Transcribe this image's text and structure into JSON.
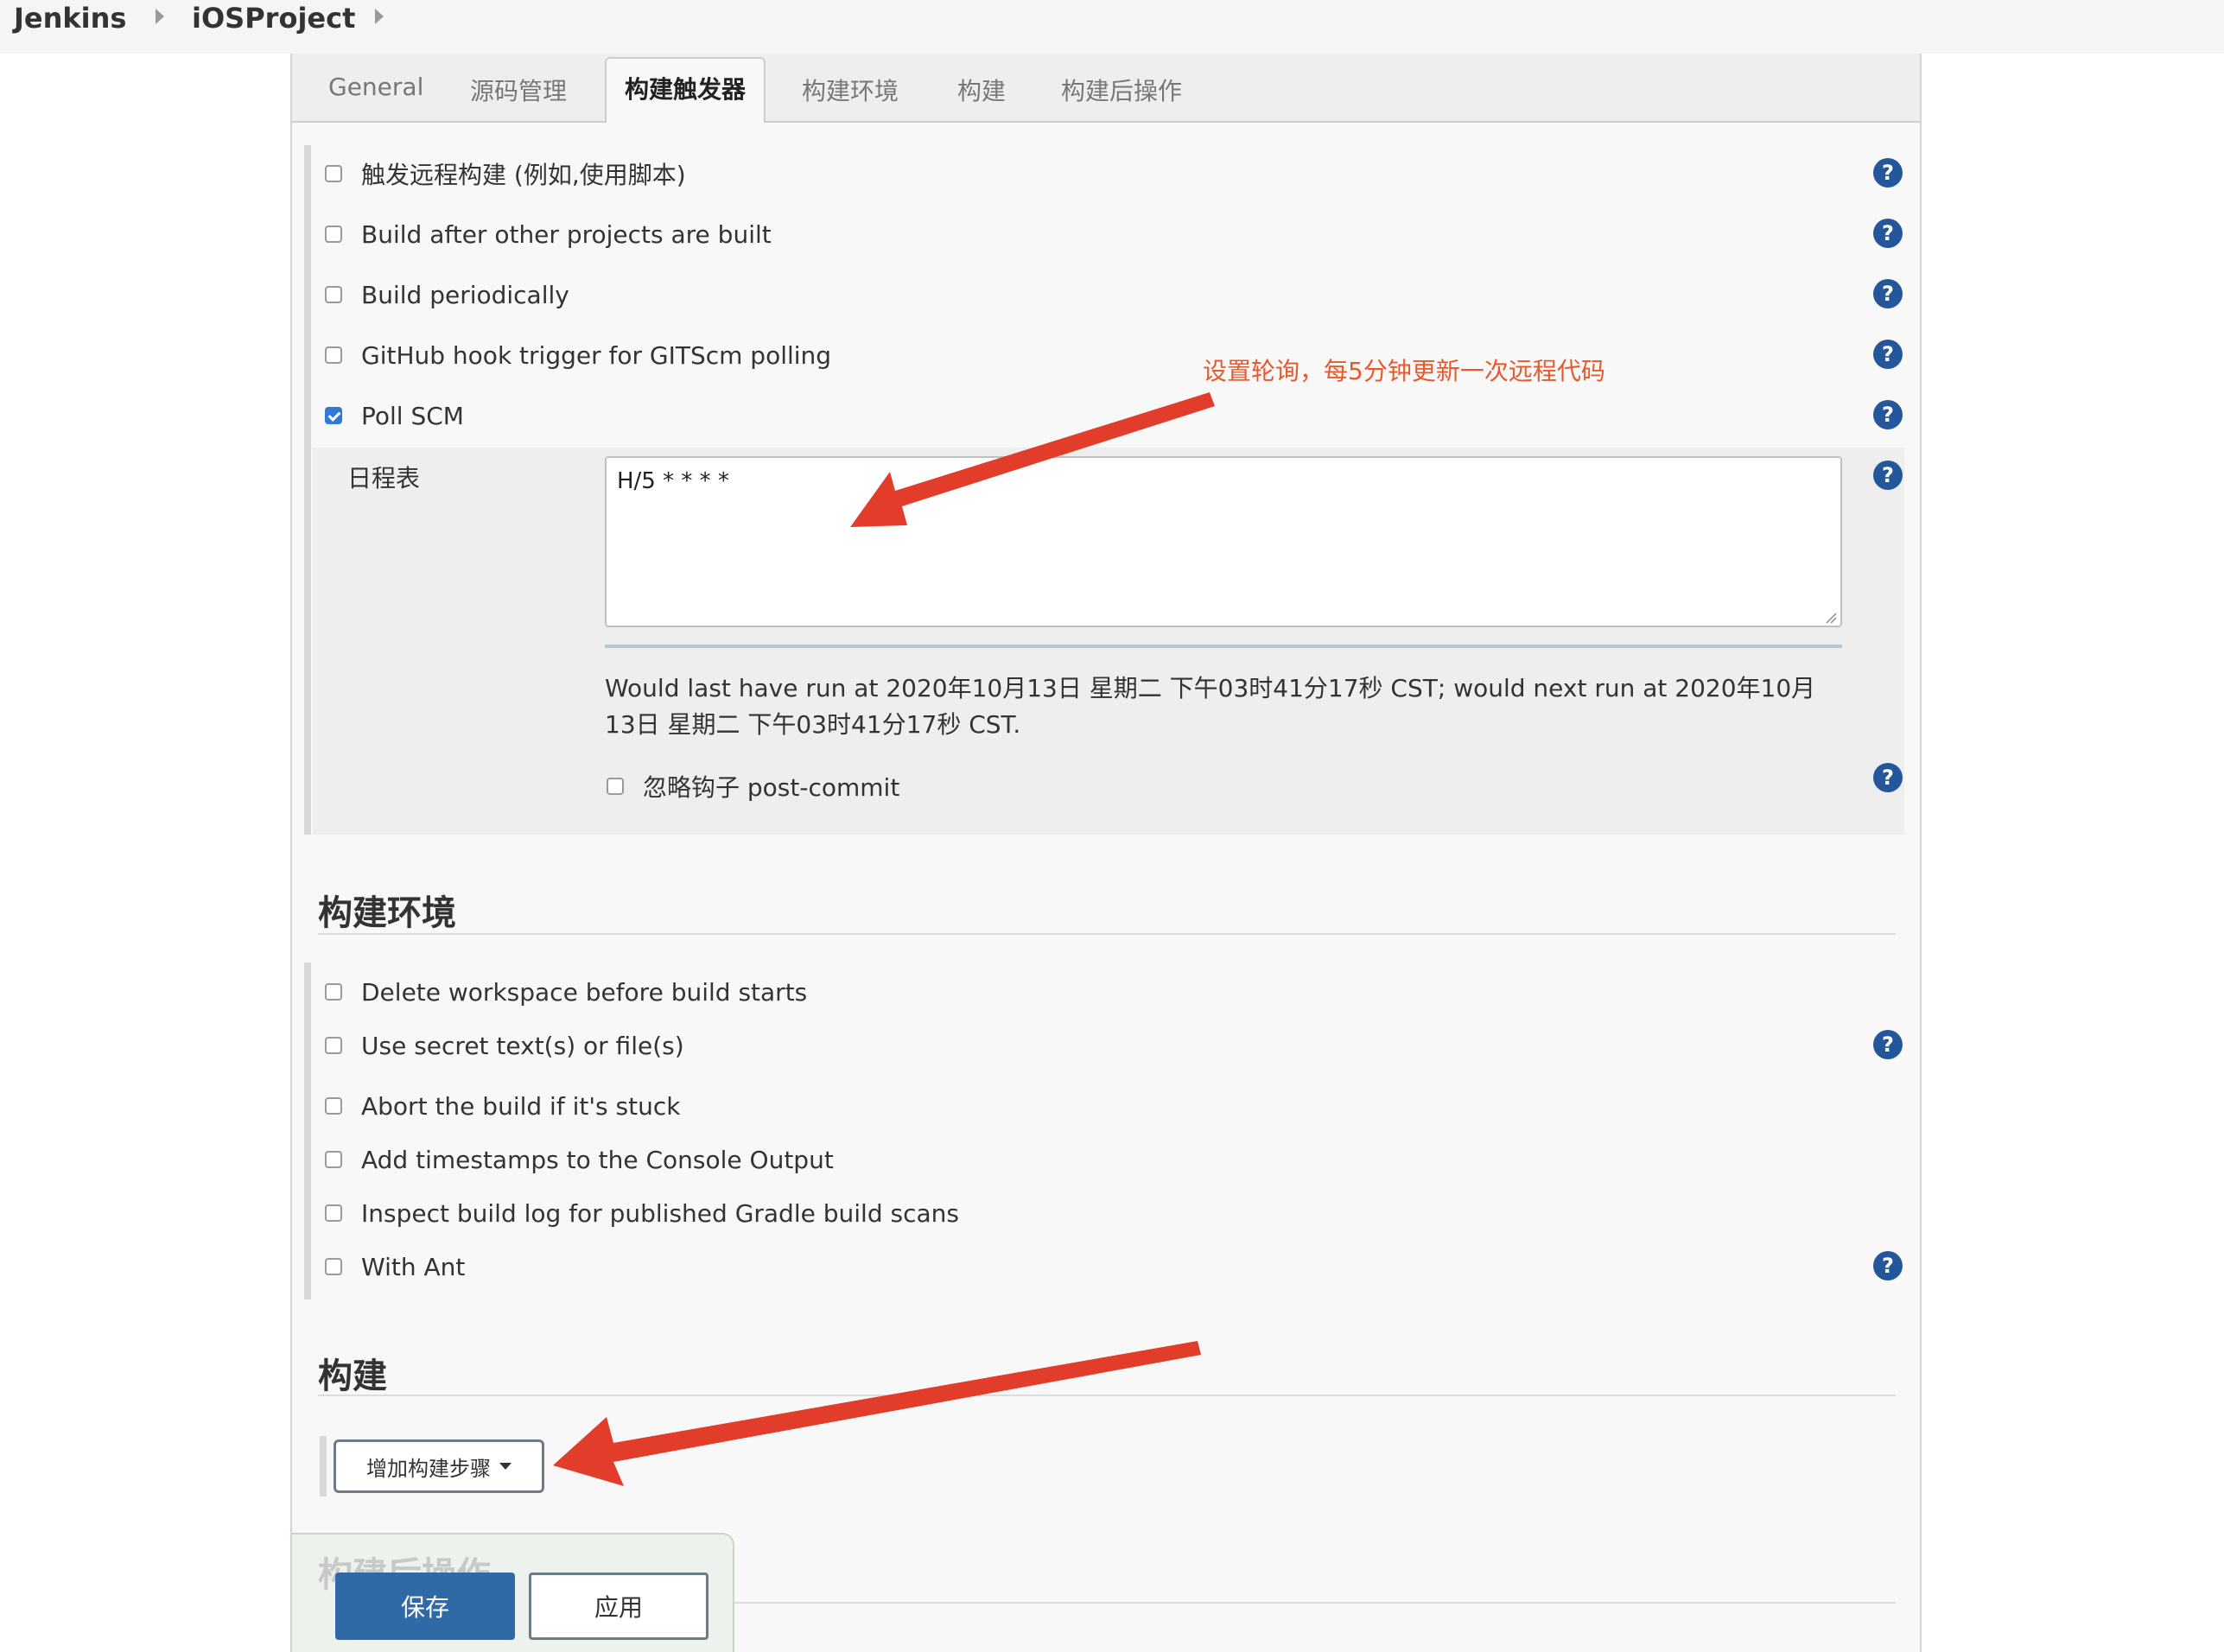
{
  "breadcrumb": [
    "Jenkins",
    "iOSProject"
  ],
  "tabs": [
    "General",
    "源码管理",
    "构建触发器",
    "构建环境",
    "构建",
    "构建后操作"
  ],
  "active_tab": "构建触发器",
  "triggers": [
    {
      "label": "触发远程构建 (例如,使用脚本)",
      "checked": false
    },
    {
      "label": "Build after other projects are built",
      "checked": false
    },
    {
      "label": "Build periodically",
      "checked": false
    },
    {
      "label": "GitHub hook trigger for GITScm polling",
      "checked": false
    },
    {
      "label": "Poll SCM",
      "checked": true
    }
  ],
  "poll_scm": {
    "schedule_label": "日程表",
    "schedule_value": "H/5 * * * *",
    "preview_text": "Would last have run at 2020年10月13日 星期二 下午03时41分17秒 CST; would next run at 2020年10月13日 星期二 下午03时41分17秒 CST.",
    "ignore_post_commit_label": "忽略钩子 post-commit",
    "ignore_post_commit_checked": false
  },
  "build_env": {
    "title": "构建环境",
    "options": [
      {
        "label": "Delete workspace before build starts",
        "checked": false
      },
      {
        "label": "Use secret text(s) or file(s)",
        "checked": false
      },
      {
        "label": "Abort the build if it's stuck",
        "checked": false
      },
      {
        "label": "Add timestamps to the Console Output",
        "checked": false
      },
      {
        "label": "Inspect build log for published Gradle build scans",
        "checked": false
      },
      {
        "label": "With Ant",
        "checked": false
      }
    ]
  },
  "build": {
    "title": "构建",
    "add_step_label": "增加构建步骤"
  },
  "post_build": {
    "title": "构建后操作"
  },
  "actions": {
    "save_label": "保存",
    "apply_label": "应用"
  },
  "help_icon_text": "?",
  "annotation": {
    "text": "设置轮询，每5分钟更新一次远程代码",
    "color": "#e8592b"
  },
  "colors": {
    "primary_button": "#2f6aa7",
    "help_icon": "#24579a",
    "checkbox_checked": "#2f7ad6",
    "arrow": "#e23c2a"
  }
}
